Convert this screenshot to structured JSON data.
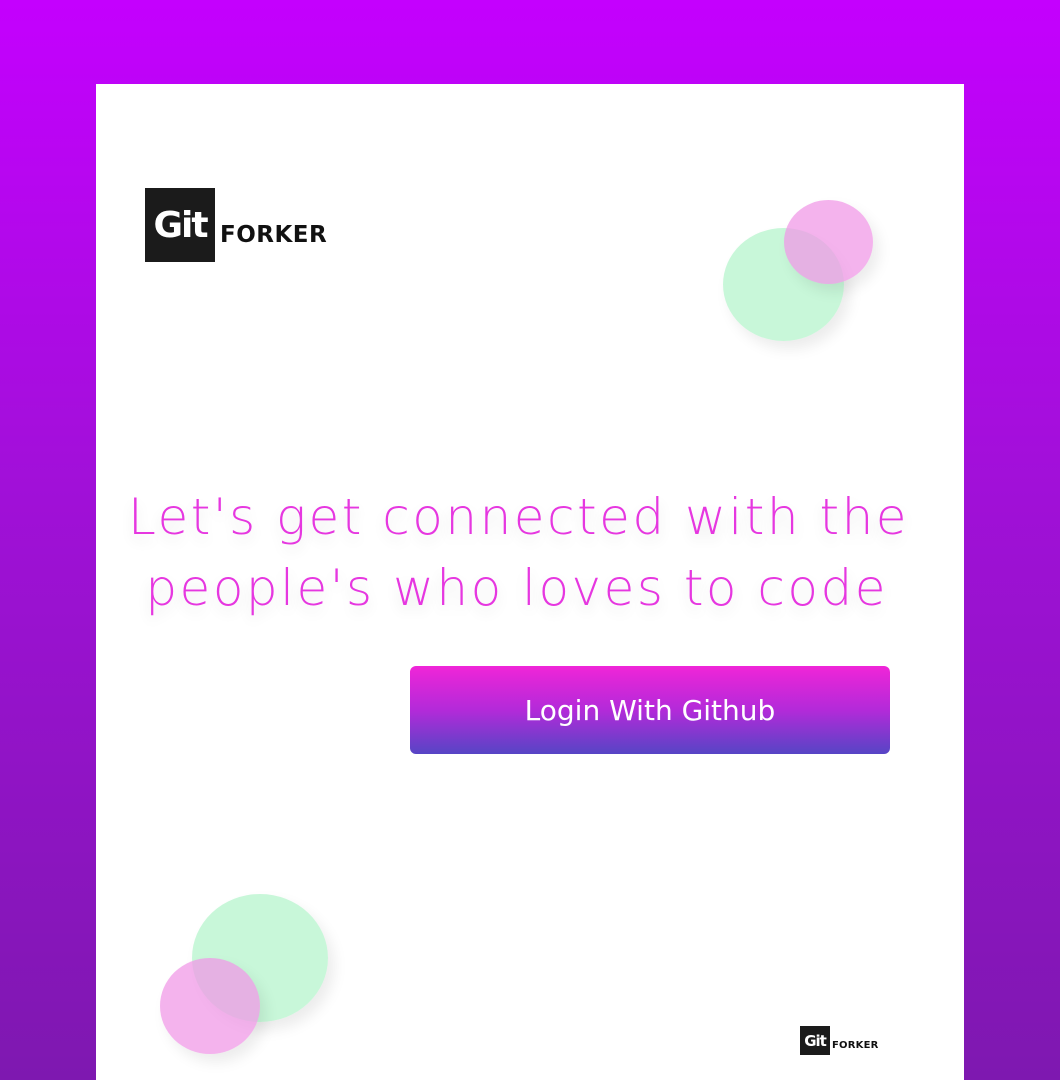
{
  "logo": {
    "mark": "Git",
    "wordmark": "FORKER"
  },
  "headline": {
    "line1": "Let's get connected with the",
    "line2": "people's who loves to code"
  },
  "login_button": {
    "label": "Login With Github"
  },
  "footer_logo": {
    "mark": "Git",
    "wordmark": "FORKER"
  },
  "colors": {
    "background_top": "#c400fe",
    "background_bottom": "#7e18b0",
    "headline": "#e637e0",
    "button_top": "#f025d8",
    "button_bottom": "#5645c5",
    "circle_green": "#bef6d2",
    "circle_pink": "#f096e6"
  }
}
